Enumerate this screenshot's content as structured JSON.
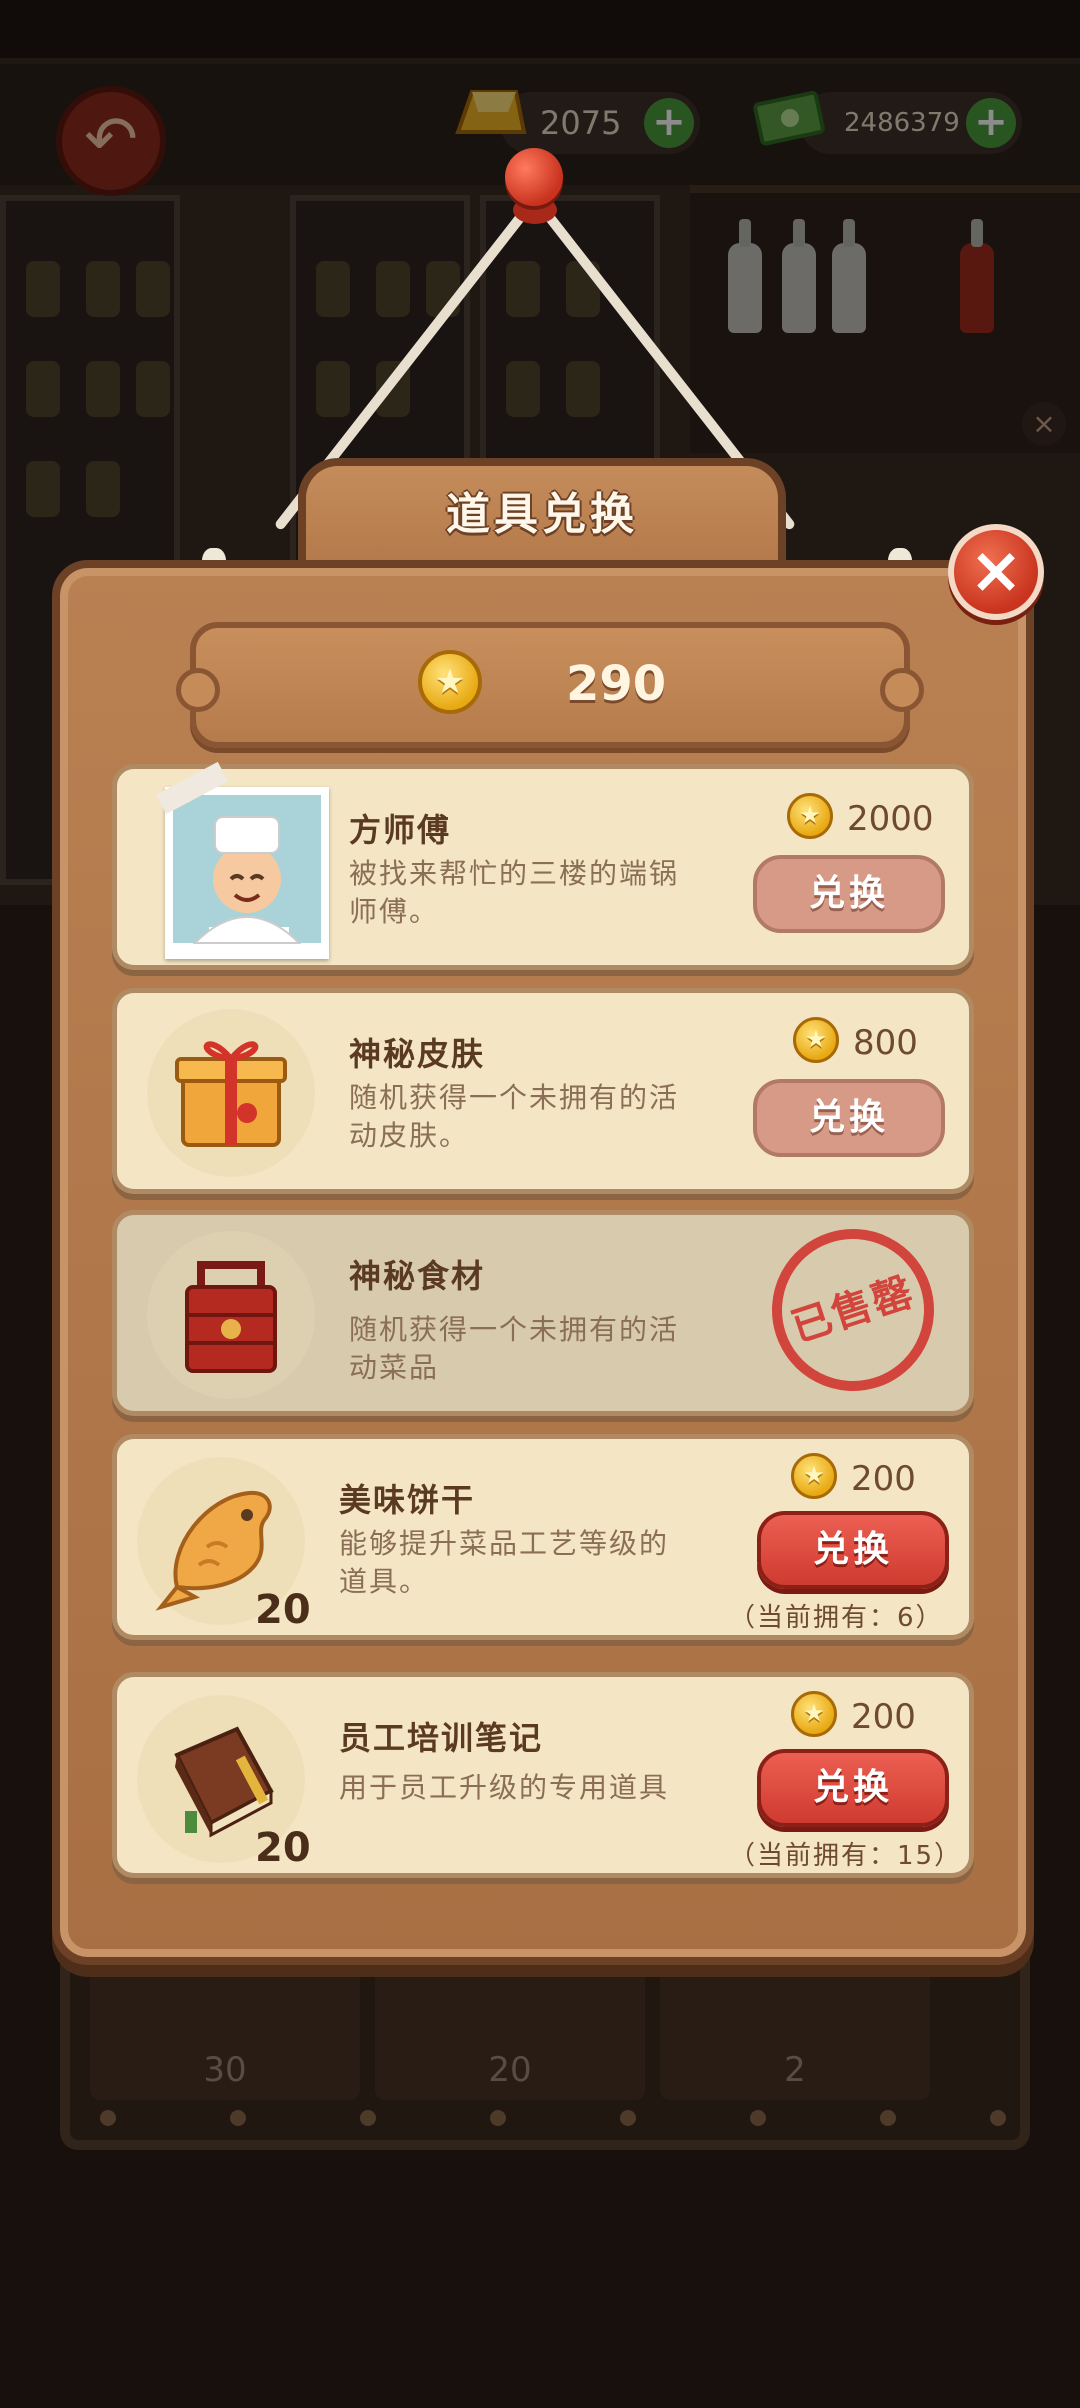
{
  "header": {
    "gold_value": "2075",
    "cash_value": "2486379"
  },
  "dialog": {
    "title": "道具兑换",
    "balance": "290",
    "items": [
      {
        "name": "方师傅",
        "desc": "被找来帮忙的三楼的端锅师傅。",
        "price": "2000",
        "button": "兑换",
        "state": "disabled"
      },
      {
        "name": "神秘皮肤",
        "desc": "随机获得一个未拥有的活动皮肤。",
        "price": "800",
        "button": "兑换",
        "state": "disabled"
      },
      {
        "name": "神秘食材",
        "desc": "随机获得一个未拥有的活动菜品",
        "stamp": "已售罄",
        "state": "soldout"
      },
      {
        "name": "美味饼干",
        "desc": "能够提升菜品工艺等级的道具。",
        "price": "200",
        "button": "兑换",
        "count": "20",
        "owned": "（当前拥有：6）",
        "state": "active"
      },
      {
        "name": "员工培训笔记",
        "desc": "用于员工升级的专用道具",
        "price": "200",
        "button": "兑换",
        "count": "20",
        "owned": "（当前拥有：15）",
        "state": "active"
      }
    ]
  },
  "background_tray": {
    "slots": [
      "30",
      "20",
      "2"
    ]
  },
  "colors": {
    "board": "#b07648",
    "card": "#f4e6c4",
    "button_active": "#d9443a",
    "button_disabled": "#d69a86",
    "stamp": "#d23a33"
  }
}
